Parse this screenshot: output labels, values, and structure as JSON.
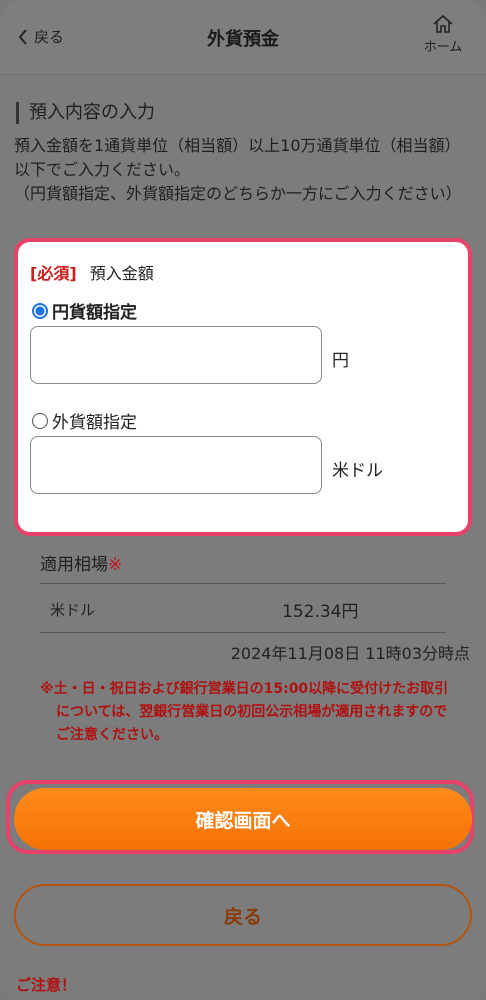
{
  "header": {
    "back_label": "戻る",
    "title": "外貨預金",
    "home_label": "ホーム"
  },
  "section": {
    "title": "預入内容の入力",
    "instruction_1": "預入金額を1通貨単位（相当額）以上10万通貨単位（相当額）以下でご入力ください。",
    "instruction_2": "（円貨額指定、外貨額指定のどちらか一方にご入力ください）"
  },
  "amount_form": {
    "required_tag": "[必須]",
    "label": "預入金額",
    "options": [
      {
        "label": "円貨額指定",
        "selected": true,
        "unit": "円",
        "value": ""
      },
      {
        "label": "外貨額指定",
        "selected": false,
        "unit": "米ドル",
        "value": ""
      }
    ]
  },
  "rate": {
    "title": "適用相場",
    "title_mark": "※",
    "currency": "米ドル",
    "value": "152.34円",
    "as_of": "2024年11月08日 11時03分時点",
    "note": "※土・日・祝日および銀行営業日の15:00以降に受付けたお取引については、翌銀行営業日の初回公示相場が適用されますのでご注意ください。"
  },
  "buttons": {
    "confirm_label": "確認画面へ",
    "back_label": "戻る"
  },
  "caution": "ご注意！",
  "colors": {
    "accent": "#f57204",
    "highlight": "#e8416a",
    "warning": "#b01010",
    "radio_on": "#1a73e8"
  },
  "icons": {
    "back": "chevron-left-icon",
    "home": "home-icon"
  }
}
